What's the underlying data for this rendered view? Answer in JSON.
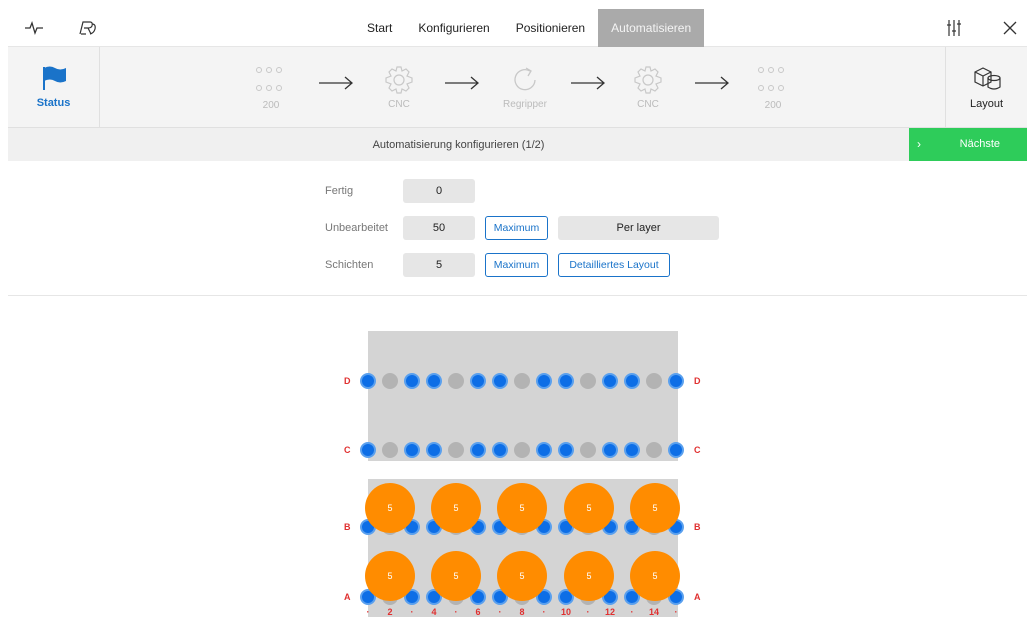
{
  "nav": {
    "tabs": [
      {
        "label": "Start",
        "active": false
      },
      {
        "label": "Konfigurieren",
        "active": false
      },
      {
        "label": "Positionieren",
        "active": false
      },
      {
        "label": "Automatisieren",
        "active": true
      }
    ],
    "icons": {
      "left": [
        "pulse-icon",
        "robot-logo-icon"
      ],
      "right": [
        "sliders-icon",
        "close-icon"
      ]
    }
  },
  "program": {
    "status_label": "Status",
    "steps": [
      {
        "label": "200",
        "icon": "grid-icon"
      },
      {
        "label": "CNC",
        "icon": "gear-icon"
      },
      {
        "label": "Regripper",
        "icon": "rotate-icon"
      },
      {
        "label": "CNC",
        "icon": "gear-icon"
      },
      {
        "label": "200",
        "icon": "grid-icon"
      }
    ],
    "layout_label": "Layout"
  },
  "config": {
    "title": "Automatisierung konfigurieren (1/2)",
    "next_label": "Nächste",
    "fields": {
      "fertig": {
        "label": "Fertig",
        "value": "0"
      },
      "unbearbeitet": {
        "label": "Unbearbeitet",
        "value": "50",
        "max_label": "Maximum",
        "per_layer_label": "Per layer"
      },
      "schichten": {
        "label": "Schichten",
        "value": "5",
        "max_label": "Maximum",
        "detail_label": "Detailliertes Layout"
      }
    }
  },
  "diagram": {
    "rows": [
      {
        "label": "D",
        "pins": [
          1,
          0,
          1,
          1,
          0,
          1,
          1,
          0,
          1,
          1,
          0,
          1,
          1,
          0,
          1
        ]
      },
      {
        "label": "C",
        "pins": [
          1,
          0,
          1,
          1,
          0,
          1,
          1,
          0,
          1,
          1,
          0,
          1,
          1,
          0,
          1
        ]
      },
      {
        "label": "B",
        "pins": [
          1,
          0,
          1,
          1,
          0,
          1,
          1,
          0,
          1,
          1,
          0,
          1,
          1,
          0,
          1
        ]
      },
      {
        "label": "A",
        "pins": [
          1,
          0,
          1,
          1,
          0,
          1,
          1,
          0,
          1,
          1,
          0,
          1,
          1,
          0,
          1
        ]
      }
    ],
    "parts_row_b": [
      "5",
      "5",
      "5",
      "5",
      "5"
    ],
    "parts_row_a": [
      "5",
      "5",
      "5",
      "5",
      "5"
    ],
    "col_labels": [
      "·",
      "2",
      "·",
      "4",
      "·",
      "6",
      "·",
      "8",
      "·",
      "10",
      "·",
      "12",
      "·",
      "14",
      "·"
    ],
    "colors": {
      "pin_on": "#0d6ee6",
      "pin_off": "#b3b3b3",
      "part": "#ff8c00",
      "label": "#e03030"
    }
  }
}
